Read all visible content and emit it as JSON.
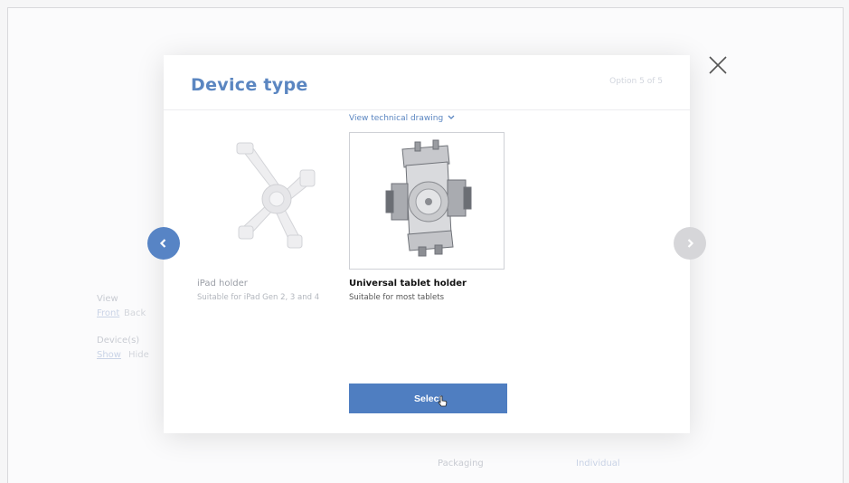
{
  "modal": {
    "title": "Device type",
    "option_prefix": "Option",
    "option_current": "5",
    "option_sep": "of",
    "option_total": "5",
    "tech_link": "View technical drawing",
    "select_label": "Select"
  },
  "cards": [
    {
      "name": "iPad holder",
      "desc": "Suitable for iPad Gen 2, 3 and 4"
    },
    {
      "name": "Universal tablet holder",
      "desc": "Suitable for most tablets"
    }
  ],
  "background": {
    "view_label": "View",
    "view_front": "Front",
    "view_back": "Back",
    "devices_label": "Device(s)",
    "devices_show": "Show",
    "devices_hide": "Hide",
    "packaging_label": "Packaging",
    "packaging_value": "Individual"
  },
  "colors": {
    "accent": "#4f7ec1",
    "title": "#5b86c1",
    "nav_prev": "#5784c5",
    "nav_next_disabled": "#d6d6d9"
  },
  "icons": [
    "close-icon",
    "chevron-left-icon",
    "chevron-right-icon",
    "chevron-down-icon",
    "pointer-cursor-icon"
  ]
}
